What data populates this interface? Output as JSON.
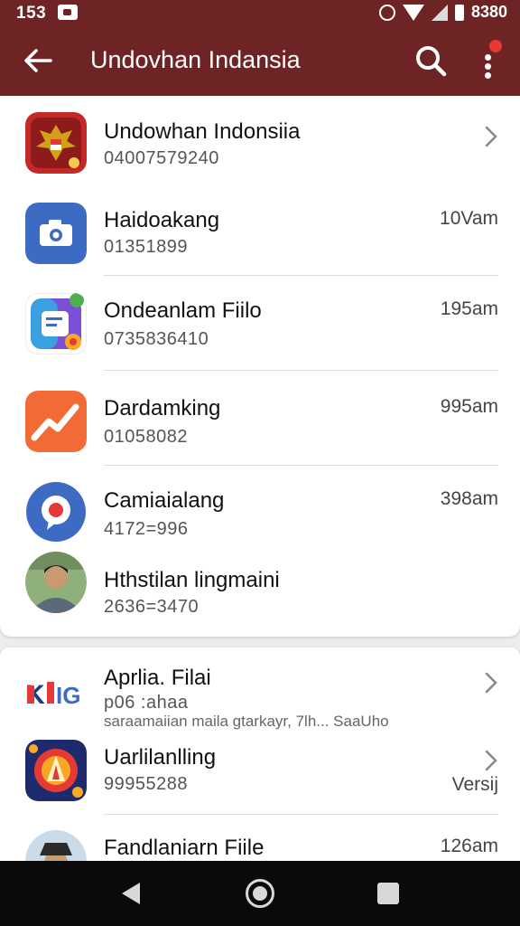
{
  "status_bar": {
    "time": "153",
    "battery_text": "8380"
  },
  "app_bar": {
    "title": "Undovhan Indansia"
  },
  "list1": [
    {
      "name": "Undowhan Indonsiia",
      "sub": "04007579240",
      "meta": "",
      "icon": "garuda-emblem-icon"
    },
    {
      "name": "Haidoakang",
      "sub": "01351899",
      "meta": "10Vam",
      "icon": "camera-icon"
    },
    {
      "name": "Ondeanlam Fiilo",
      "sub": "0735836410",
      "meta": "195am",
      "icon": "document-icon"
    },
    {
      "name": "Dardamking",
      "sub": "01058082",
      "meta": "995am",
      "icon": "chart-line-icon"
    },
    {
      "name": "Camiaialang",
      "sub": "4172=996",
      "meta": "398am",
      "icon": "chat-bubble-icon"
    },
    {
      "name": "Hthstilan lingmaini",
      "sub": "2636=3470",
      "meta": "",
      "icon": "person-avatar-icon"
    }
  ],
  "list2": [
    {
      "name": "Aprlia. Filai",
      "sub": "p06 :ahaa",
      "sub2": "saraamaiian maila gtarkayr, 7lh... SaaUho",
      "meta": "",
      "icon": "kio-logo-icon"
    },
    {
      "name": "Uarlilanlling",
      "sub": "99955288",
      "meta": "Versij",
      "icon": "flame-emblem-icon"
    },
    {
      "name": "Fandlaniarn Fiile",
      "sub": "",
      "meta": "126am",
      "icon": "person-hat-avatar-icon"
    }
  ],
  "colors": {
    "appbar": "#6e2424",
    "accent_blue": "#3d6bc4",
    "accent_orange": "#f26a35"
  }
}
